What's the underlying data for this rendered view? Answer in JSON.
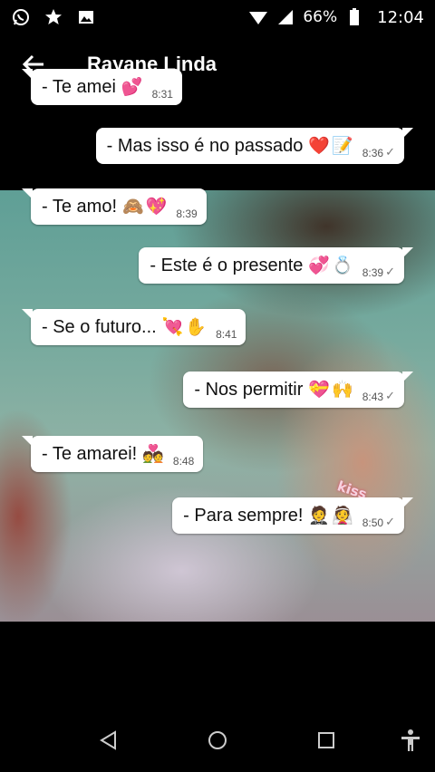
{
  "status_bar": {
    "left_icons": [
      "whatsapp-icon",
      "star-icon",
      "image-icon"
    ],
    "right_icons": [
      "wifi-icon",
      "signal-icon"
    ],
    "battery": "66%",
    "time": "12:04"
  },
  "header": {
    "contact_name": "Rayane Linda",
    "back_icon": "arrow-left-icon"
  },
  "wallpaper": {
    "sticker_text": "kiss"
  },
  "messages": [
    {
      "direction": "in",
      "text": "- Te amei",
      "emoji": "💕",
      "time": "8:31",
      "tick": false
    },
    {
      "direction": "out",
      "text": "- Mas isso é no passado",
      "emoji": "❤️📝",
      "time": "8:36",
      "tick": true
    },
    {
      "direction": "in",
      "text": "-  Te amo!",
      "emoji": "🙈💖",
      "time": "8:39",
      "tick": false
    },
    {
      "direction": "out",
      "text": "- Este é o presente",
      "emoji": "💞💍",
      "time": "8:39",
      "tick": true
    },
    {
      "direction": "in",
      "text": "-  Se o futuro...",
      "emoji": "💘✋",
      "time": "8:41",
      "tick": false
    },
    {
      "direction": "out",
      "text": "-  Nos permitir",
      "emoji": "💝🙌",
      "time": "8:43",
      "tick": true
    },
    {
      "direction": "in",
      "text": "- Te amarei!",
      "emoji": "💑",
      "time": "8:48",
      "tick": false
    },
    {
      "direction": "out",
      "text": "- Para sempre!",
      "emoji": "🤵👰",
      "time": "8:50",
      "tick": true
    }
  ],
  "nav_bar": {
    "buttons": [
      "back-triangle-icon",
      "home-circle-icon",
      "recents-square-icon",
      "accessibility-icon"
    ]
  },
  "colors": {
    "bubble": "#ffffff",
    "background": "#000000",
    "status_text": "#ffffff"
  }
}
